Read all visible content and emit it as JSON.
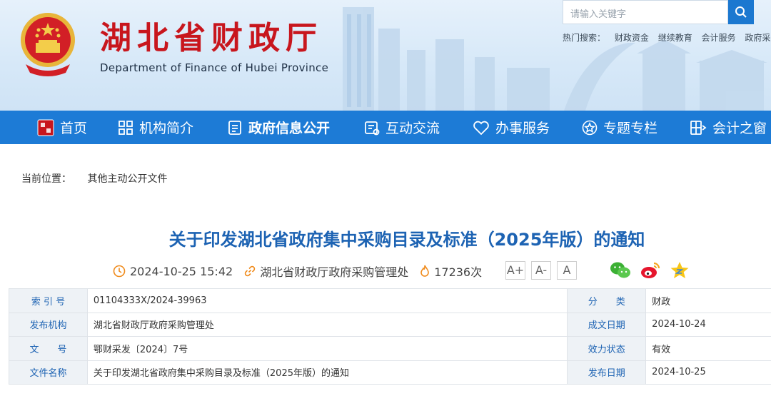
{
  "header": {
    "title": "湖北省财政厅",
    "subtitle": "Department of Finance of Hubei Province",
    "search_placeholder": "请输入关键字",
    "hot_label": "热门搜索：",
    "hot_terms": [
      "财政资金",
      "继续教育",
      "会计服务",
      "政府采购"
    ]
  },
  "nav": {
    "items": [
      {
        "label": "首页",
        "icon": "hubei-finance-logo-icon"
      },
      {
        "label": "机构简介",
        "icon": "grid-icon"
      },
      {
        "label": "政府信息公开",
        "icon": "document-icon"
      },
      {
        "label": "互动交流",
        "icon": "chat-icon"
      },
      {
        "label": "办事服务",
        "icon": "heart-icon"
      },
      {
        "label": "专题专栏",
        "icon": "star-circle-icon"
      },
      {
        "label": "会计之窗",
        "icon": "window-icon"
      }
    ],
    "active_index": 2
  },
  "breadcrumb": {
    "label": "当前位置：",
    "current": "其他主动公开文件"
  },
  "article": {
    "title": "关于印发湖北省政府集中采购目录及标准（2025年版）的通知",
    "datetime": "2024-10-25 15:42",
    "source": "湖北省财政厅政府采购管理处",
    "views": "17236次",
    "font_sizes": [
      "A+",
      "A-",
      "A"
    ],
    "share": [
      "wechat-icon",
      "weibo-icon",
      "qzone-icon"
    ]
  },
  "info_table": {
    "rows": [
      {
        "label1": "索 引 号",
        "value1": "01104333X/2024-39963",
        "label2": "分　　类",
        "value2": "财政"
      },
      {
        "label1": "发布机构",
        "value1": "湖北省财政厅政府采购管理处",
        "label2": "成文日期",
        "value2": "2024-10-24"
      },
      {
        "label1": "文　　号",
        "value1": "鄂财采发〔2024〕7号",
        "label2": "效力状态",
        "value2": "有效"
      },
      {
        "label1": "文件名称",
        "value1": "关于印发湖北省政府集中采购目录及标准（2025年版）的通知",
        "label2": "发布日期",
        "value2": "2024-10-25"
      }
    ]
  },
  "colors": {
    "brand_red": "#c8161d",
    "nav_blue": "#1d7bd6",
    "title_blue": "#1d63b3",
    "meta_orange": "#f08c1e"
  }
}
